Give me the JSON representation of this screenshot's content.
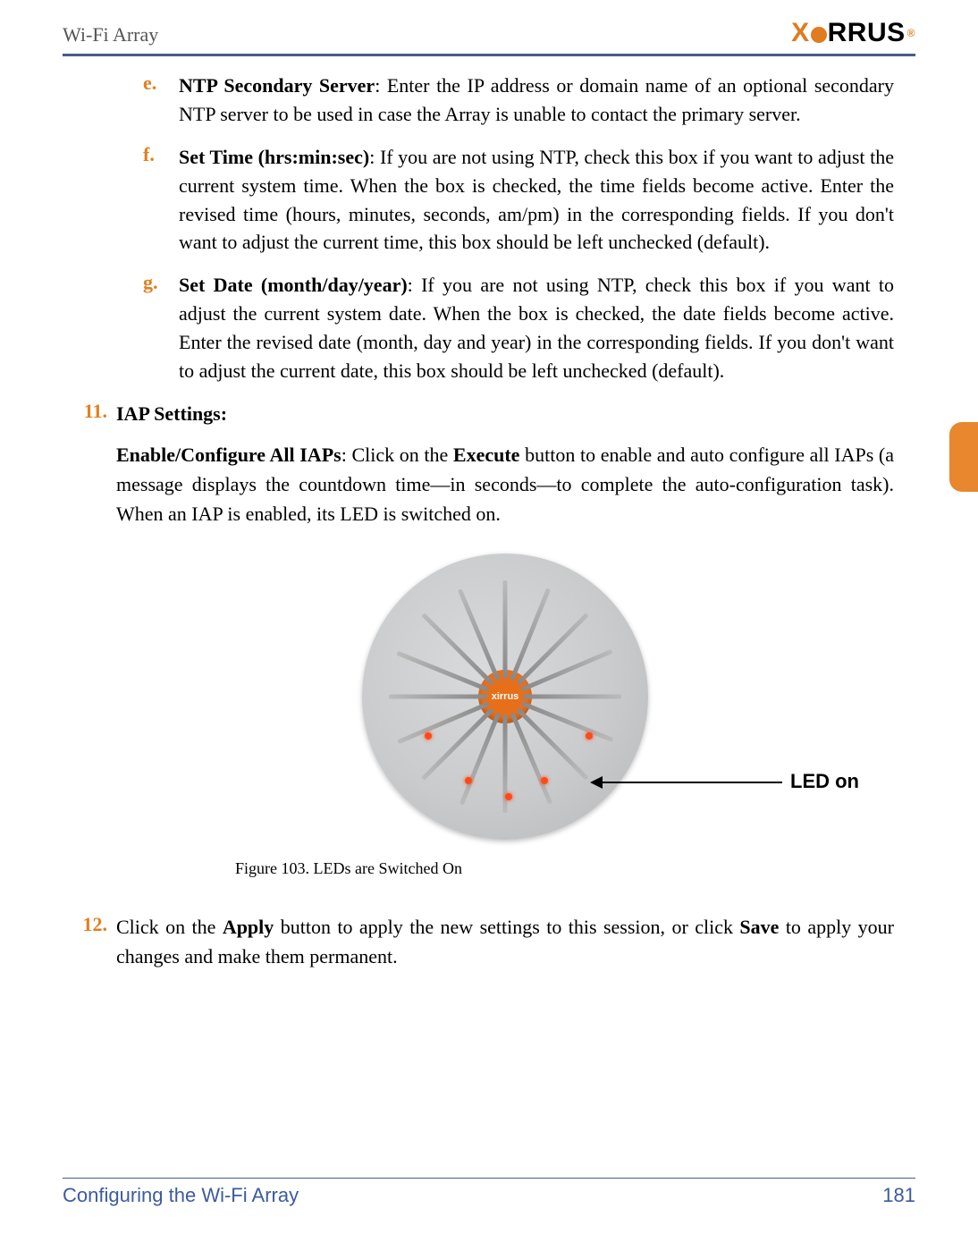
{
  "header": {
    "title": "Wi-Fi Array",
    "brand": "XIRRUS"
  },
  "sublist": {
    "e": {
      "marker": "e.",
      "title": "NTP Secondary Server",
      "text": ": Enter the IP address or domain name of an optional secondary NTP server to be used in case the Array is unable to contact the primary server."
    },
    "f": {
      "marker": "f.",
      "title": "Set Time (hrs:min:sec)",
      "text": ": If you are not using NTP, check this box if you want to adjust the current system time. When the box is checked, the time fields become active. Enter the revised time (hours, minutes, seconds, am/pm) in the corresponding fields. If you don't want to adjust the current time, this box should be left unchecked (default)."
    },
    "g": {
      "marker": "g.",
      "title": "Set Date (month/day/year)",
      "text": ": If you are not using NTP, check this box if you want to adjust the current system date. When the box is checked, the date fields become active. Enter the revised date (month, day and year) in the corresponding fields. If you don't want to adjust the current date, this box should be left unchecked (default)."
    }
  },
  "item11": {
    "marker": "11.",
    "heading": "IAP Settings:",
    "para_lead": "Enable/Configure All IAPs",
    "para_mid1": ": Click on the ",
    "para_bold": "Execute",
    "para_mid2": " button to enable and auto configure all IAPs (a message displays the countdown time—in seconds—to complete the auto-configuration task). When an IAP is enabled, its LED is switched on."
  },
  "figure": {
    "callout": "LED on",
    "hub_label": "xirrus",
    "caption": "Figure 103. LEDs are Switched On"
  },
  "item12": {
    "marker": "12.",
    "t1": "Click on the ",
    "b1": "Apply",
    "t2": " button to apply the new settings to this session, or click ",
    "b2": "Save",
    "t3": " to apply your changes and make them permanent."
  },
  "footer": {
    "section": "Configuring the Wi-Fi Array",
    "page": "181"
  }
}
